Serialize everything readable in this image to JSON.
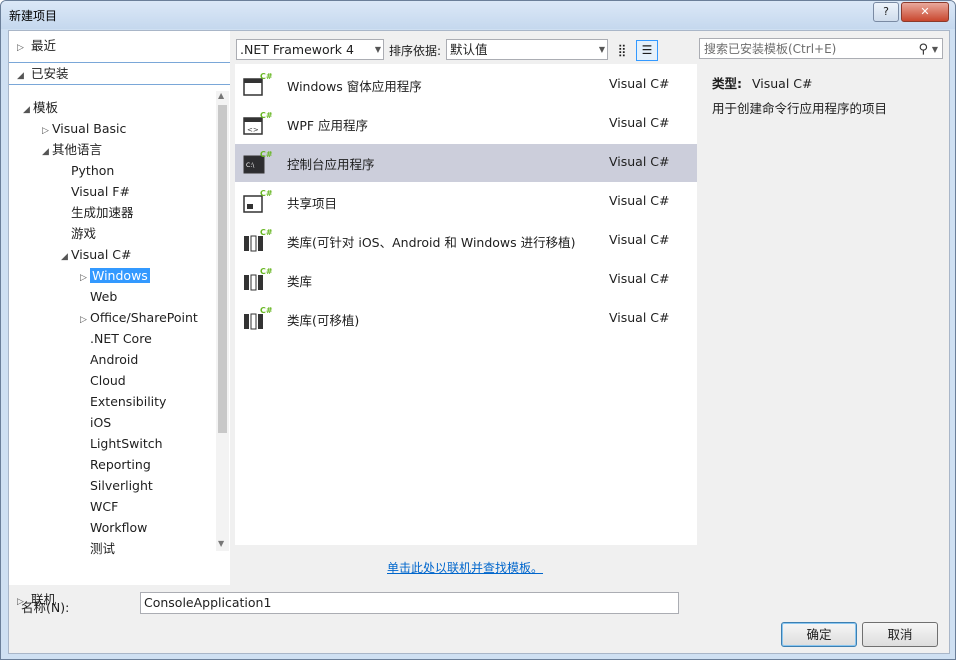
{
  "window": {
    "title": "新建项目",
    "help": "?",
    "close": "✕"
  },
  "left": {
    "recent": "最近",
    "installed": "已安装",
    "online": "联机",
    "tree": [
      {
        "label": "模板",
        "indent": 0,
        "exp": "◢"
      },
      {
        "label": "Visual Basic",
        "indent": 1,
        "exp": "▷"
      },
      {
        "label": "其他语言",
        "indent": 1,
        "exp": "◢"
      },
      {
        "label": "Python",
        "indent": 2,
        "exp": ""
      },
      {
        "label": "Visual F#",
        "indent": 2,
        "exp": ""
      },
      {
        "label": "生成加速器",
        "indent": 2,
        "exp": ""
      },
      {
        "label": "游戏",
        "indent": 2,
        "exp": ""
      },
      {
        "label": "Visual C#",
        "indent": 2,
        "exp": "◢"
      },
      {
        "label": "Windows",
        "indent": 3,
        "exp": "▷",
        "selected": true
      },
      {
        "label": "Web",
        "indent": 3,
        "exp": ""
      },
      {
        "label": "Office/SharePoint",
        "indent": 3,
        "exp": "▷"
      },
      {
        "label": ".NET Core",
        "indent": 3,
        "exp": ""
      },
      {
        "label": "Android",
        "indent": 3,
        "exp": ""
      },
      {
        "label": "Cloud",
        "indent": 3,
        "exp": ""
      },
      {
        "label": "Extensibility",
        "indent": 3,
        "exp": ""
      },
      {
        "label": "iOS",
        "indent": 3,
        "exp": ""
      },
      {
        "label": "LightSwitch",
        "indent": 3,
        "exp": ""
      },
      {
        "label": "Reporting",
        "indent": 3,
        "exp": ""
      },
      {
        "label": "Silverlight",
        "indent": 3,
        "exp": ""
      },
      {
        "label": "WCF",
        "indent": 3,
        "exp": ""
      },
      {
        "label": "Workflow",
        "indent": 3,
        "exp": ""
      },
      {
        "label": "测试",
        "indent": 3,
        "exp": ""
      }
    ]
  },
  "toolbar": {
    "framework": ".NET Framework 4",
    "sort_label": "排序依据:",
    "sort_value": "默认值",
    "grid_view_icon": "grid-view-icon",
    "list_view_icon": "list-view-icon"
  },
  "templates": [
    {
      "name": "Windows 窗体应用程序",
      "lang": "Visual C#",
      "icon": "winforms-icon"
    },
    {
      "name": "WPF 应用程序",
      "lang": "Visual C#",
      "icon": "wpf-icon"
    },
    {
      "name": "控制台应用程序",
      "lang": "Visual C#",
      "icon": "console-icon",
      "selected": true
    },
    {
      "name": "共享项目",
      "lang": "Visual C#",
      "icon": "shared-project-icon"
    },
    {
      "name": "类库(可针对 iOS、Android 和 Windows 进行移植)",
      "lang": "Visual C#",
      "icon": "portable-library-icon"
    },
    {
      "name": "类库",
      "lang": "Visual C#",
      "icon": "class-library-icon"
    },
    {
      "name": "类库(可移植)",
      "lang": "Visual C#",
      "icon": "portable-class-library-icon"
    }
  ],
  "online_link": "单击此处以联机并查找模板。",
  "search": {
    "placeholder": "搜索已安装模板(Ctrl+E)"
  },
  "detail": {
    "type_label": "类型:",
    "type_value": "Visual C#",
    "description": "用于创建命令行应用程序的项目"
  },
  "form": {
    "name_label": "名称(N):",
    "name_value": "ConsoleApplication1"
  },
  "buttons": {
    "ok": "确定",
    "cancel": "取消"
  },
  "colors": {
    "selection": "#3399ff",
    "row_selected": "#cccedb",
    "link": "#0066cc",
    "csharp_green": "#68b723"
  }
}
